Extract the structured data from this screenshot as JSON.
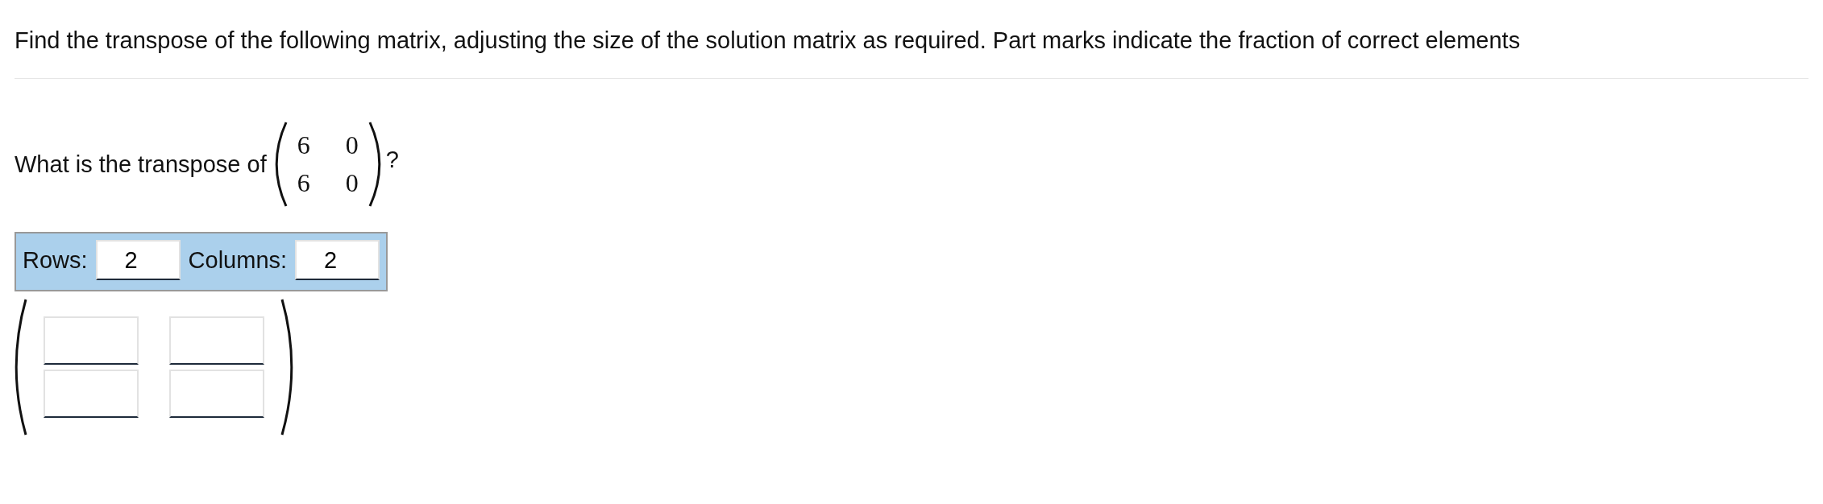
{
  "instructions": "Find the transpose of the following matrix, adjusting the size of the solution matrix as required.  Part marks indicate the fraction of correct elements",
  "question": {
    "text": "What is the transpose of",
    "matrix": [
      [
        "6",
        "0"
      ],
      [
        "6",
        "0"
      ]
    ],
    "suffix": "?"
  },
  "size_controls": [
    {
      "label": "Rows:",
      "value": "2"
    },
    {
      "label": "Columns:",
      "value": "2"
    }
  ],
  "answer_matrix": {
    "rows": [
      [
        "",
        ""
      ],
      [
        "",
        ""
      ]
    ]
  }
}
